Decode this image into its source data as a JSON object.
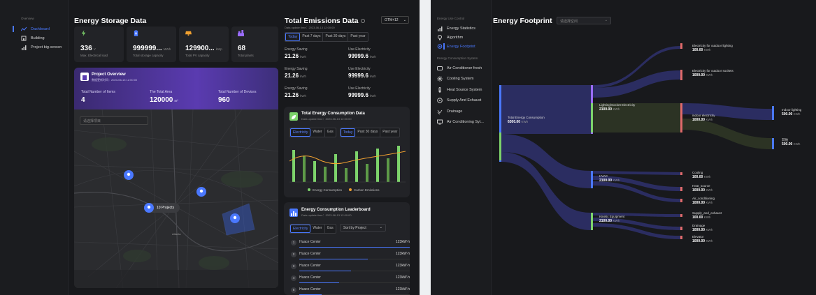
{
  "left": {
    "sidebar": {
      "heading": "Overview",
      "items": [
        {
          "label": "Dashboard",
          "icon": "chart-line-icon",
          "active": true
        },
        {
          "label": "Building",
          "icon": "building-icon",
          "active": false
        },
        {
          "label": "Project big-screen",
          "icon": "bar-chart-icon",
          "active": false
        }
      ]
    },
    "title": "Energy Storage Data",
    "kpis": [
      {
        "value": "336",
        "unit": "V",
        "label": "Max. Electrical load",
        "icon": "lightning-icon",
        "color": "#7dd36b"
      },
      {
        "value": "999999...",
        "unit": "MWh",
        "label": "Total storage capacity",
        "icon": "battery-icon",
        "color": "#4a78ff"
      },
      {
        "value": "129900...",
        "unit": "kWp",
        "label": "Total PV capacity",
        "icon": "solar-panel-icon",
        "color": "#f0a030"
      },
      {
        "value": "68",
        "unit": "",
        "label": "Total plants",
        "icon": "plant-icon",
        "color": "#9a6cff"
      }
    ],
    "project": {
      "title": "Project Overview",
      "sub": "数据更新时间：2023-06-13 12:00:00",
      "stats": [
        {
          "label": "Total Number of Items",
          "value": "4",
          "unit": ""
        },
        {
          "label": "The Total Area",
          "value": "120000",
          "unit": "m²"
        },
        {
          "label": "Total Number of Devices",
          "value": "960",
          "unit": ""
        }
      ],
      "select_placeholder": "请选择项目",
      "cluster_label": "10 Projects",
      "city_label": "Atlanta"
    },
    "emissions": {
      "title": "Total Emissions Data",
      "timezone": "GTM+12",
      "update": "Data update time：2023-06-13 12:00:00",
      "tabs": [
        "Today",
        "Past 7 days",
        "Past 30 days",
        "Past year"
      ],
      "rows": [
        {
          "l1": "Energy Saving",
          "v1": "21.26",
          "u1": "kWh",
          "l2": "Use Electricity",
          "v2": "99999.6",
          "u2": "kWh"
        },
        {
          "l1": "Energy Saving",
          "v1": "21.26",
          "u1": "kWh",
          "l2": "Use Electricity",
          "v2": "99999.6",
          "u2": "kWh"
        },
        {
          "l1": "Energy Saving",
          "v1": "21.26",
          "u1": "kWh",
          "l2": "Use Electricity",
          "v2": "99999.6",
          "u2": "kWh"
        }
      ]
    },
    "consumption": {
      "title": "Total Energy Consumption Data",
      "update": "Data update time：2023-06-13 12:00:00",
      "types": [
        "Electricity",
        "Water",
        "Gas"
      ],
      "tabs": [
        "Today",
        "Past 30 days",
        "Past year"
      ],
      "legend": [
        {
          "name": "Energy Consumption",
          "color": "#7dd36b"
        },
        {
          "name": "Carbon Emissions",
          "color": "#f0a030"
        }
      ]
    },
    "leaderboard": {
      "title": "Energy Consumption Leaderboard",
      "update": "Data update time：2023-06-13 12:00:00",
      "types": [
        "Electricity",
        "Water",
        "Gas"
      ],
      "sort_label": "Sort by Project",
      "rows": [
        {
          "rank": "1",
          "name": "Huace Center",
          "value": "123kW·h",
          "pct": 100
        },
        {
          "rank": "2",
          "name": "Huace Center",
          "value": "123kW·h",
          "pct": 62
        },
        {
          "rank": "3",
          "name": "Huace Center",
          "value": "123kW·h",
          "pct": 47
        },
        {
          "rank": "4",
          "name": "Huace Center",
          "value": "123kW·h",
          "pct": 36
        },
        {
          "rank": "5",
          "name": "Huace Center",
          "value": "123kW·h",
          "pct": 20
        }
      ]
    }
  },
  "right": {
    "sidebar": {
      "heading": "Energy Use Control",
      "items": [
        {
          "label": "Energy Statistics",
          "icon": "bar-chart-icon",
          "active": false
        },
        {
          "label": "Algorithm",
          "icon": "lightbulb-icon",
          "active": false
        },
        {
          "label": "Energy Footprint",
          "icon": "location-pin-icon",
          "active": true
        }
      ],
      "heading2": "Energy Consumption System",
      "items2": [
        {
          "label": "Air Conditioner fresh",
          "icon": "air-conditioner-icon"
        },
        {
          "label": "Cooling System",
          "icon": "snowflake-icon"
        },
        {
          "label": "Heat Source System",
          "icon": "thermometer-icon"
        },
        {
          "label": "Supply And Exhaust",
          "icon": "fan-icon"
        },
        {
          "label": "Drainage",
          "icon": "drain-icon"
        },
        {
          "label": "Air Conditioning Syt...",
          "icon": "monitor-icon"
        }
      ]
    },
    "title": "Energy Footprint",
    "select_placeholder": "请选择空间",
    "nodes": [
      {
        "name": "Total Energy Consumption",
        "value": "6300.00",
        "unit": "KWh"
      },
      {
        "name": "Lighting/Socket Electricity",
        "value": "2100.00",
        "unit": "KWh"
      },
      {
        "name": "HVAC",
        "value": "2100.00",
        "unit": "KWh"
      },
      {
        "name": "Kinetic Equipment",
        "value": "2100.00",
        "unit": "KWh"
      },
      {
        "name": "Electricity for outdoor lighting",
        "value": "100.00",
        "unit": "KWh"
      },
      {
        "name": "Electricity for outdoor sockets",
        "value": "1000.00",
        "unit": "KWh"
      },
      {
        "name": "indoor electricity",
        "value": "1000.00",
        "unit": "KWh"
      },
      {
        "name": "Indoor lighting",
        "value": "500.00",
        "unit": "KWh"
      },
      {
        "name": "其他",
        "value": "500.00",
        "unit": "KWh"
      },
      {
        "name": "Cooling",
        "value": "100.00",
        "unit": "KWh"
      },
      {
        "name": "Heat_source",
        "value": "1000.00",
        "unit": "KWh"
      },
      {
        "name": "Air_conditioning",
        "value": "1000.00",
        "unit": "KWh"
      },
      {
        "name": "Supply_and_exhaust",
        "value": "100.00",
        "unit": "KWh"
      },
      {
        "name": "Drainage",
        "value": "1000.00",
        "unit": "KWh"
      },
      {
        "name": "Elevator",
        "value": "1000.00",
        "unit": "KWh"
      }
    ]
  }
}
